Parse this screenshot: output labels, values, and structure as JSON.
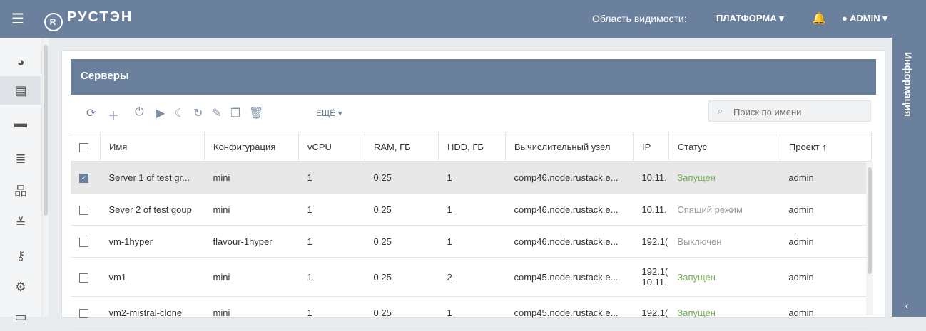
{
  "header": {
    "logo_text": "РУСТЭН",
    "scope_label": "Область видимости:",
    "scope_value": "ПЛАТФОРМА ▾",
    "user": "ADMIN ▾"
  },
  "sidebar": {
    "icons": [
      "dashboard-icon",
      "servers-icon",
      "drives-icon",
      "database-icon",
      "network-icon",
      "settings-sliders-icon",
      "key-icon",
      "cogs-icon",
      "monitor-icon"
    ]
  },
  "panel": {
    "title": "Серверы",
    "more_label": "ЕЩЁ ▾",
    "search_placeholder": "Поиск по имени"
  },
  "table": {
    "headers": [
      "Имя",
      "Конфигурация",
      "vCPU",
      "RAM, ГБ",
      "HDD, ГБ",
      "Вычислительный узел",
      "IP",
      "Статус",
      "Проект ↑"
    ],
    "rows": [
      {
        "name": "Server 1 of test gr...",
        "config": "mini",
        "vcpu": "1",
        "ram": "0.25",
        "hdd": "1",
        "node": "comp46.node.rustack.e...",
        "ip": "10.11.",
        "ip2": "",
        "status": "Запущен",
        "project": "admin"
      },
      {
        "name": "Sever 2 of test goup",
        "config": "mini",
        "vcpu": "1",
        "ram": "0.25",
        "hdd": "1",
        "node": "comp46.node.rustack.e...",
        "ip": "10.11.",
        "ip2": "",
        "status": "Спящий режим",
        "project": "admin"
      },
      {
        "name": "vm-1hyper",
        "config": "flavour-1hyper",
        "vcpu": "1",
        "ram": "0.25",
        "hdd": "1",
        "node": "comp46.node.rustack.e...",
        "ip": "192.1(",
        "ip2": "",
        "status": "Выключен",
        "project": "admin"
      },
      {
        "name": "vm1",
        "config": "mini",
        "vcpu": "1",
        "ram": "0.25",
        "hdd": "2",
        "node": "comp45.node.rustack.e...",
        "ip": "192.1(",
        "ip2": "10.11.",
        "status": "Запущен",
        "project": "admin"
      },
      {
        "name": "vm2-mistral-clone",
        "config": "mini",
        "vcpu": "1",
        "ram": "0.25",
        "hdd": "1",
        "node": "comp45.node.rustack.e...",
        "ip": "192.1(",
        "ip2": "",
        "status": "Запущен",
        "project": "admin"
      }
    ]
  },
  "info_panel": {
    "label": "Информация"
  },
  "colors": {
    "header_bg": "#6a809d",
    "running": "#73b352",
    "inactive": "#999999"
  }
}
